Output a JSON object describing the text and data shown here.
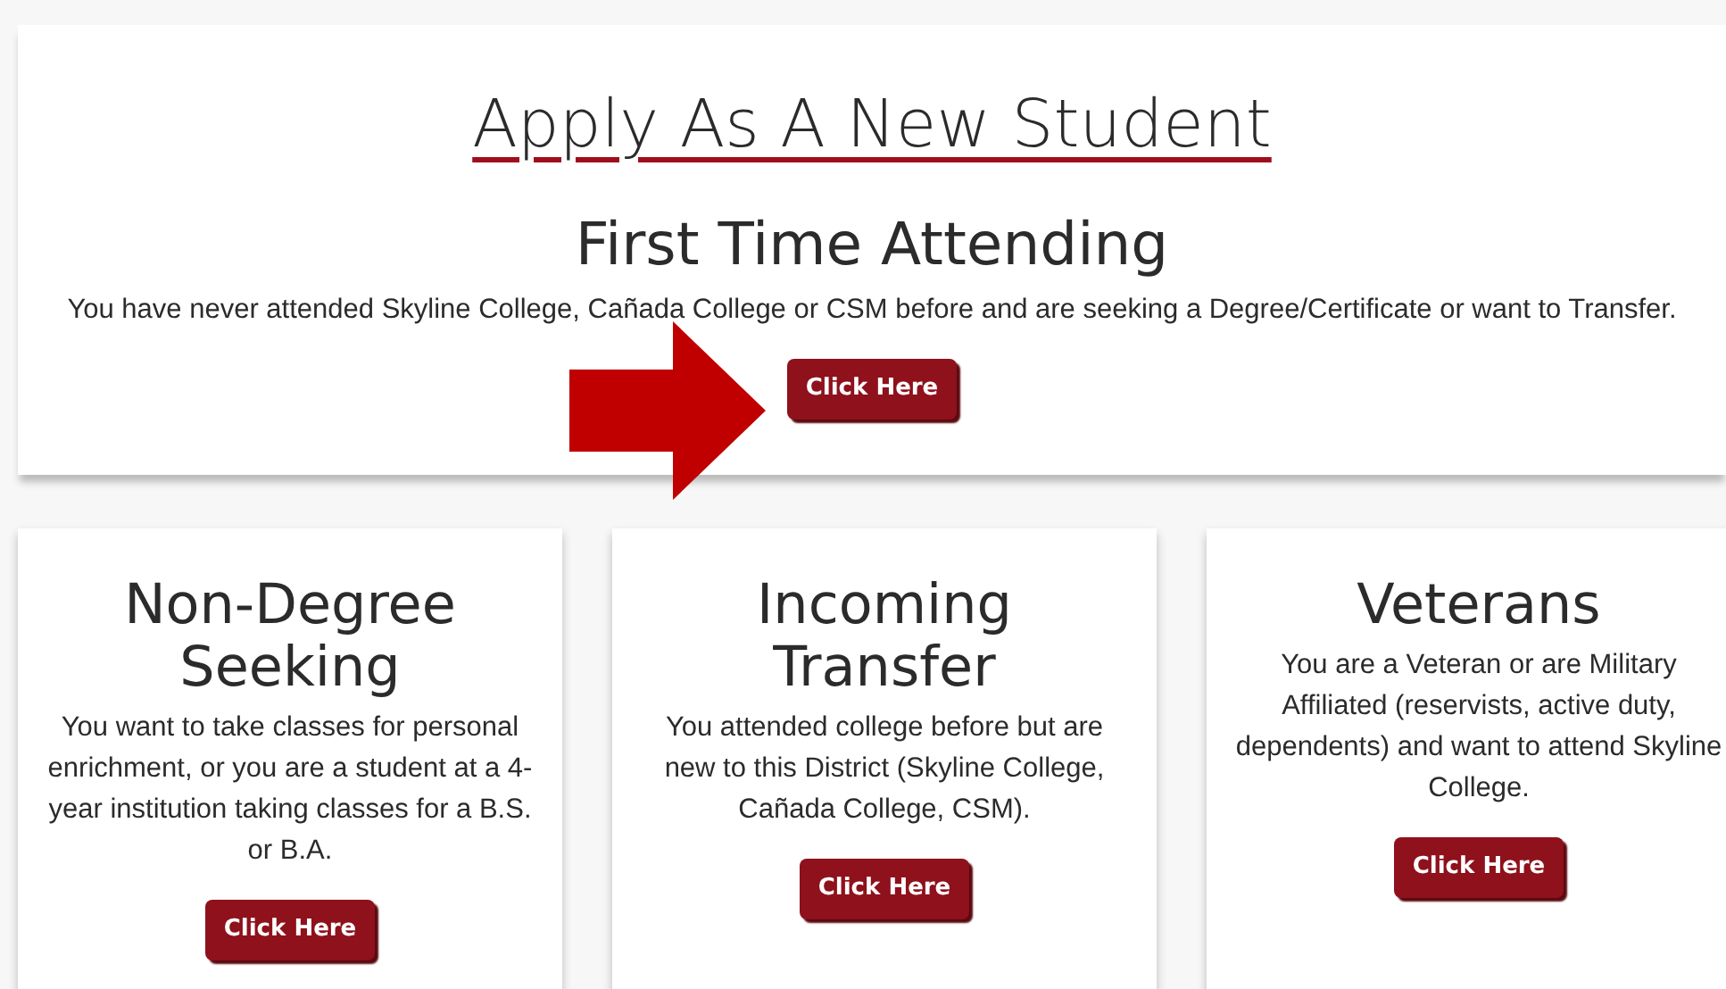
{
  "heading": "Apply As A New Student",
  "featured": {
    "title": "First Time Attending",
    "description": "You have never attended Skyline College, Cañada College or CSM before and are seeking a Degree/Certificate or want to Transfer.",
    "button": "Click Here"
  },
  "options": [
    {
      "title": "Non-Degree Seeking",
      "description": "You want to take classes for personal enrichment, or you are a student at a 4-year institution taking classes for a B.S. or B.A.",
      "button": "Click Here"
    },
    {
      "title": "Incoming Transfer",
      "description": "You attended college before but are new to this District (Skyline College, Cañada College, CSM).",
      "button": "Click Here"
    },
    {
      "title": "Veterans",
      "description": "You are a Veteran or are Military Affiliated (reservists, active duty, dependents) and want to attend Skyline College.",
      "button": "Click Here"
    }
  ]
}
